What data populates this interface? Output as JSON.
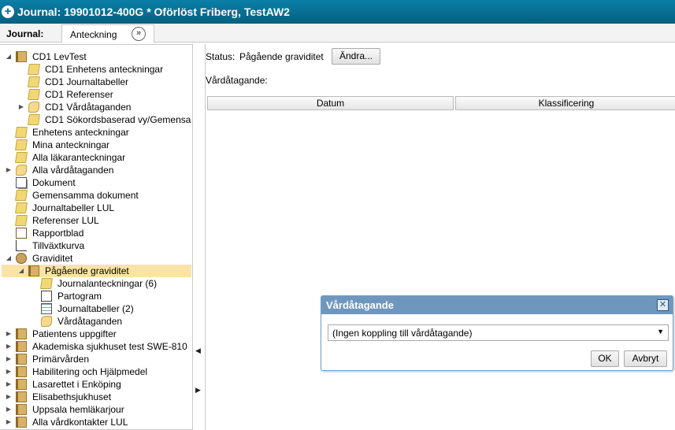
{
  "window": {
    "title": "Journal: 19901012-400G * Oförlöst Friberg, TestAW2",
    "icon": "plus-icon"
  },
  "tabs": {
    "journal": "Journal:",
    "anteckning": "Anteckning",
    "next_icon": "chevron-right-circle-icon",
    "next_glyph": "»"
  },
  "tree": [
    {
      "label": "CD1 LevTest",
      "icon": "book",
      "expand": "◢"
    },
    {
      "label": "CD1 Enhetens anteckningar",
      "icon": "folder",
      "expand": ""
    },
    {
      "label": "CD1 Journaltabeller",
      "icon": "folder",
      "expand": ""
    },
    {
      "label": "CD1 Referenser",
      "icon": "folder",
      "expand": ""
    },
    {
      "label": "CD1 Vårdåtaganden",
      "icon": "hand",
      "expand": "▶"
    },
    {
      "label": "CD1 Sökordsbaserad vy/Gemensa",
      "icon": "folder",
      "expand": ""
    },
    {
      "label": "Enhetens anteckningar",
      "icon": "folder",
      "expand": ""
    },
    {
      "label": "Mina anteckningar",
      "icon": "folder",
      "expand": ""
    },
    {
      "label": "Alla läkaranteckningar",
      "icon": "folder",
      "expand": ""
    },
    {
      "label": "Alla vårdåtaganden",
      "icon": "hand",
      "expand": "▶"
    },
    {
      "label": "Dokument",
      "icon": "doc",
      "expand": ""
    },
    {
      "label": "Gemensamma dokument",
      "icon": "folder",
      "expand": ""
    },
    {
      "label": "Journaltabeller LUL",
      "icon": "folder",
      "expand": ""
    },
    {
      "label": "Referenser LUL",
      "icon": "folder",
      "expand": ""
    },
    {
      "label": "Rapportblad",
      "icon": "report",
      "expand": ""
    },
    {
      "label": "Tillväxtkurva",
      "icon": "chart",
      "expand": ""
    },
    {
      "label": "Graviditet",
      "icon": "preg",
      "expand": "◢"
    },
    {
      "label": "Pågående graviditet",
      "icon": "book",
      "expand": "◢"
    },
    {
      "label": "Journalanteckningar (6)",
      "icon": "folder",
      "expand": ""
    },
    {
      "label": "Partogram",
      "icon": "partogram",
      "expand": ""
    },
    {
      "label": "Journaltabeller (2)",
      "icon": "table",
      "expand": ""
    },
    {
      "label": "Vårdåtaganden",
      "icon": "hand",
      "expand": ""
    },
    {
      "label": "Patientens uppgifter",
      "icon": "book",
      "expand": "▶"
    },
    {
      "label": "Akademiska sjukhuset test SWE-810",
      "icon": "book",
      "expand": "▶"
    },
    {
      "label": "Primärvården",
      "icon": "book",
      "expand": "▶"
    },
    {
      "label": "Habilitering och Hjälpmedel",
      "icon": "book",
      "expand": "▶"
    },
    {
      "label": "Lasarettet i Enköping",
      "icon": "book",
      "expand": "▶"
    },
    {
      "label": "Elisabethsjukhuset",
      "icon": "book",
      "expand": "▶"
    },
    {
      "label": "Uppsala hemläkarjour",
      "icon": "book",
      "expand": "▶"
    },
    {
      "label": "Alla vårdkontakter LUL",
      "icon": "book",
      "expand": "▶"
    }
  ],
  "splitter": {
    "collapse_left": "◀",
    "expand_right": "▶"
  },
  "main": {
    "status_label": "Status:",
    "status_value": "Pågående graviditet",
    "change_button": "Ändra...",
    "vardatagande_label": "Vårdåtagande:",
    "columns": [
      "Datum",
      "Klassificering"
    ]
  },
  "dialog": {
    "title": "Vårdåtagande",
    "close_glyph": "✕",
    "select_value": "(Ingen koppling till vårdåtagande)",
    "caret": "▼",
    "ok": "OK",
    "cancel": "Avbryt"
  }
}
